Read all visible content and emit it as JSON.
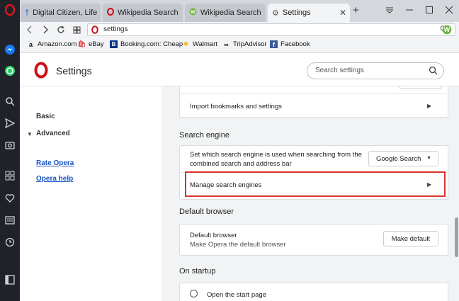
{
  "tabs": [
    {
      "title": "Digital Citizen, Life in a",
      "icon": "digital-citizen-icon",
      "active": false
    },
    {
      "title": "Wikipedia Search exte",
      "icon": "opera-icon",
      "active": false
    },
    {
      "title": "Wikipedia Search",
      "icon": "wikipedia-w-icon",
      "active": false
    },
    {
      "title": "Settings",
      "icon": "gear-icon",
      "active": true
    }
  ],
  "address": {
    "value": "settings"
  },
  "bookmarks": [
    {
      "label": "Amazon.com",
      "icon": "amazon-icon"
    },
    {
      "label": "eBay",
      "icon": "ebay-icon"
    },
    {
      "label": "Booking.com: Cheap",
      "icon": "booking-icon"
    },
    {
      "label": "Walmart",
      "icon": "walmart-icon"
    },
    {
      "label": "TripAdvisor",
      "icon": "tripadvisor-icon"
    },
    {
      "label": "Facebook",
      "icon": "facebook-icon"
    }
  ],
  "header": {
    "title": "Settings",
    "search_placeholder": "Search settings"
  },
  "nav": {
    "basic": "Basic",
    "advanced": "Advanced",
    "rate": "Rate Opera",
    "help": "Opera help"
  },
  "settings": {
    "import_label": "Import bookmarks and settings",
    "search_engine": {
      "section_title": "Search engine",
      "description_line1": "Set which search engine is used when searching from the",
      "description_line2": "combined search and address bar",
      "selected_engine": "Google Search",
      "manage_label": "Manage search engines"
    },
    "default_browser": {
      "section_title": "Default browser",
      "label": "Default browser",
      "sublabel": "Make Opera the default browser",
      "button": "Make default"
    },
    "startup": {
      "section_title": "On startup",
      "option1": "Open the start page"
    }
  },
  "colors": {
    "opera_red": "#cc0f16",
    "highlight_box": "#d9342b",
    "link": "#1a55c5",
    "sidebar": "#1f2329"
  }
}
